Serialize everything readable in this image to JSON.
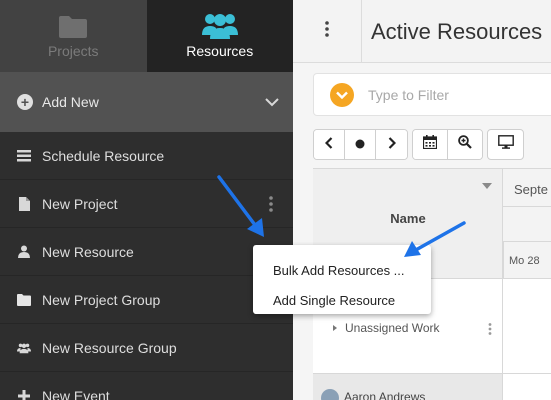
{
  "sidebar": {
    "tabs": [
      {
        "label": "Projects",
        "icon": "folder-icon",
        "active": false
      },
      {
        "label": "Resources",
        "icon": "people-icon",
        "active": true
      }
    ],
    "add_new": {
      "label": "Add New",
      "icon": "plus-circle-icon"
    },
    "items": [
      {
        "label": "Schedule Resource",
        "icon": "list-icon"
      },
      {
        "label": "New Project",
        "icon": "file-icon"
      },
      {
        "label": "New Resource",
        "icon": "person-icon"
      },
      {
        "label": "New Project Group",
        "icon": "folder-icon"
      },
      {
        "label": "New Resource Group",
        "icon": "people-icon"
      },
      {
        "label": "New Event",
        "icon": "plus-icon"
      }
    ]
  },
  "main": {
    "title": "Active Resources",
    "filter": {
      "placeholder": "Type to Filter"
    },
    "grid": {
      "name_header": "Name",
      "month": "Septe",
      "day": "Mo 28",
      "unassigned": "Unassigned Work",
      "person": "Aaron Andrews"
    }
  },
  "popup_menu": {
    "items": [
      "Bulk Add Resources ...",
      "Add Single Resource"
    ]
  },
  "colors": {
    "accent_teal": "#3bbfd6",
    "filter_orange": "#f5a623",
    "arrow_blue": "#1e73e8"
  }
}
